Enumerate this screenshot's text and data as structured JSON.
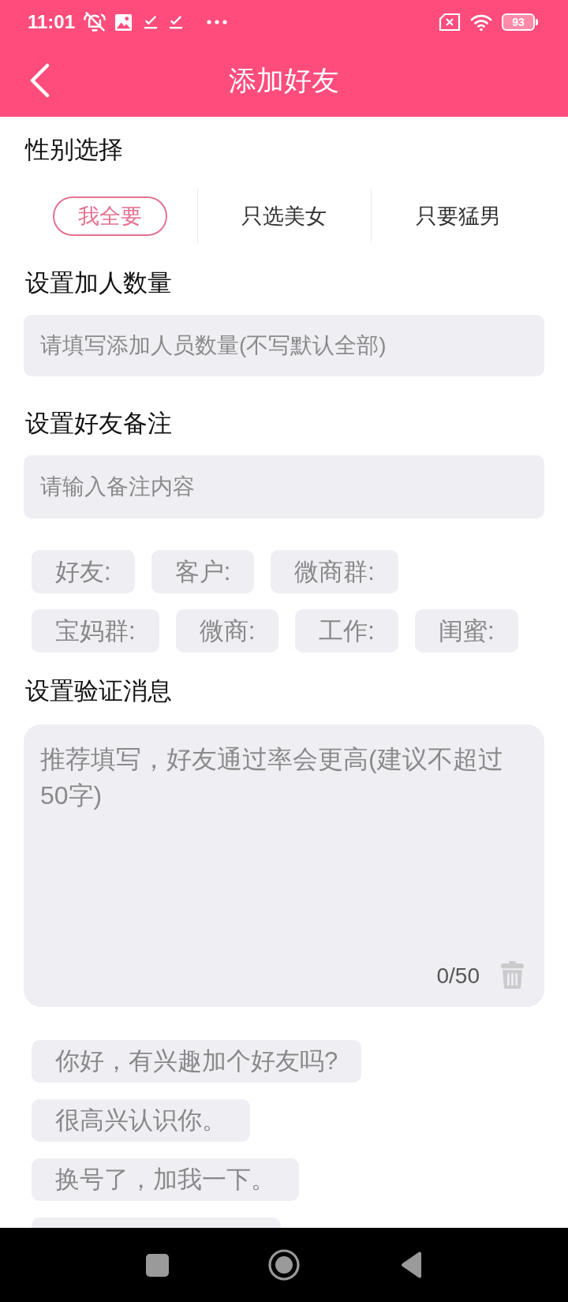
{
  "status_bar": {
    "time": "11:01",
    "battery": "93"
  },
  "header": {
    "title": "添加好友"
  },
  "gender": {
    "label": "性别选择",
    "options": [
      {
        "label": "我全要",
        "selected": true
      },
      {
        "label": "只选美女",
        "selected": false
      },
      {
        "label": "只要猛男",
        "selected": false
      }
    ]
  },
  "add_count": {
    "label": "设置加人数量",
    "placeholder": "请填写添加人员数量(不写默认全部)"
  },
  "remark": {
    "label": "设置好友备注",
    "placeholder": "请输入备注内容",
    "tags": [
      "好友:",
      "客户:",
      "微商群:",
      "宝妈群:",
      "微商:",
      "工作:",
      "闺蜜:"
    ]
  },
  "verify": {
    "label": "设置验证消息",
    "placeholder": "推荐填写，好友通过率会更高(建议不超过50字)",
    "counter": "0/50",
    "suggestions": [
      "你好，有兴趣加个好友吗?",
      "很高兴认识你。",
      "换号了，加我一下。"
    ]
  }
}
